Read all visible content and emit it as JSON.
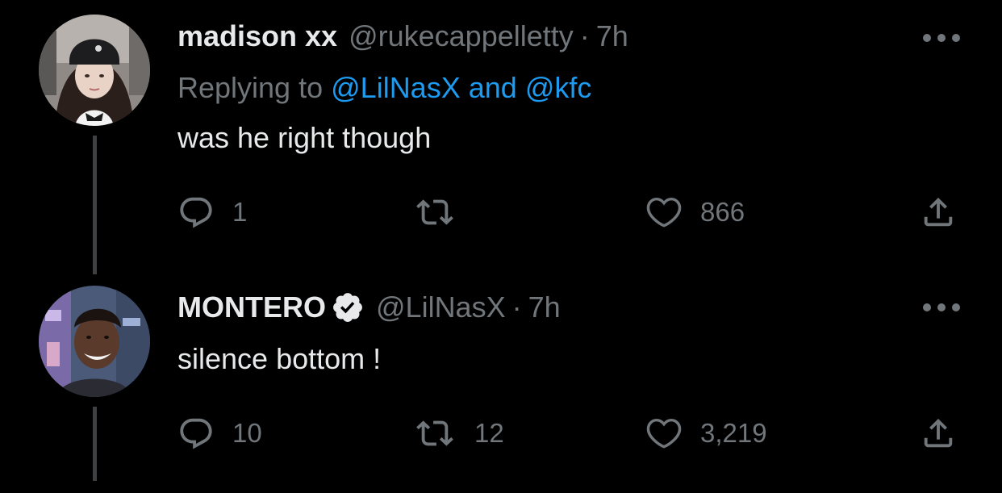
{
  "colors": {
    "background": "#000000",
    "primary_text": "#e7e9ea",
    "secondary_text": "#71767b",
    "link": "#1d9bf0",
    "thread_line": "#3e4144"
  },
  "tweets": [
    {
      "display_name": "madison xx",
      "handle": "@rukecappelletty",
      "separator": "·",
      "time": "7h",
      "replying_prefix": "Replying to",
      "replying_mention_1": "@LilNasX",
      "replying_joiner": "and",
      "replying_mention_2": "@kfc",
      "text": "was he right though",
      "replies": "1",
      "retweets": "",
      "likes": "866",
      "icons": [
        "reply-icon",
        "retweet-icon",
        "like-icon",
        "share-icon",
        "more-icon"
      ]
    },
    {
      "display_name": "MONTERO",
      "verified": true,
      "handle": "@LilNasX",
      "separator": "·",
      "time": "7h",
      "text": "silence bottom !",
      "replies": "10",
      "retweets": "12",
      "likes": "3,219",
      "icons": [
        "verified-badge-icon",
        "reply-icon",
        "retweet-icon",
        "like-icon",
        "share-icon",
        "more-icon"
      ]
    }
  ]
}
